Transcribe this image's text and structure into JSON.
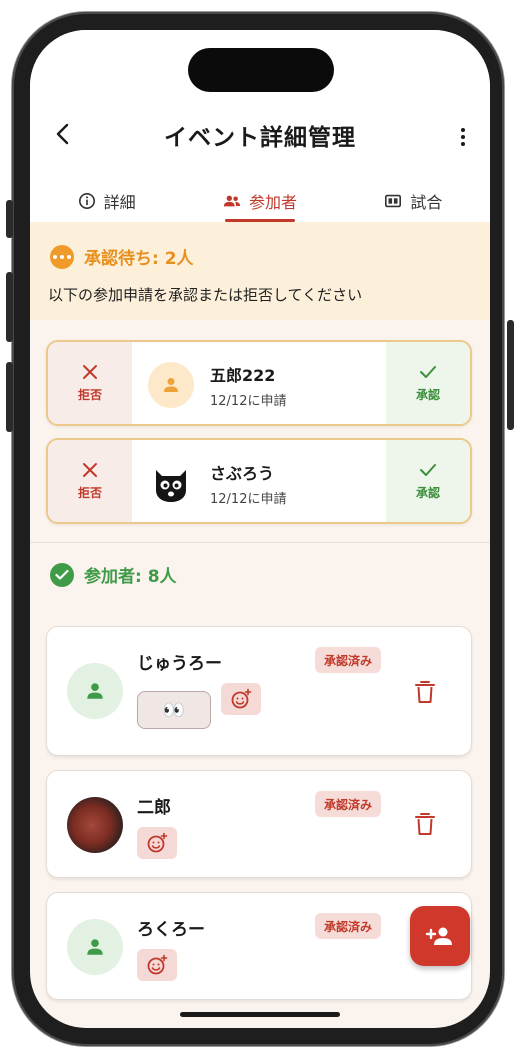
{
  "header": {
    "title": "イベント詳細管理"
  },
  "tabs": [
    {
      "label": "詳細",
      "icon": "info-icon"
    },
    {
      "label": "参加者",
      "icon": "people-icon",
      "active": true
    },
    {
      "label": "試合",
      "icon": "match-icon"
    }
  ],
  "pending": {
    "title": "承認待ち: 2人",
    "description": "以下の参加申請を承認または拒否してください",
    "reject_label": "拒否",
    "approve_label": "承認",
    "requests": [
      {
        "name": "五郎222",
        "date": "12/12に申請",
        "avatar": "person-icon"
      },
      {
        "name": "さぶろう",
        "date": "12/12に申請",
        "avatar": "cat-avatar"
      }
    ]
  },
  "participants": {
    "title": "参加者: 8人",
    "members": [
      {
        "name": "じゅうろー",
        "badge": "承認済み",
        "avatar": "person-icon",
        "reaction": "👀"
      },
      {
        "name": "二郎",
        "badge": "承認済み",
        "avatar": "photo"
      },
      {
        "name": "ろくろー",
        "badge": "承認済み",
        "avatar": "person-icon"
      }
    ]
  },
  "colors": {
    "accent": "#c0392b",
    "pending": "#e8901f",
    "success": "#3f9b47",
    "background": "#fbf4ee"
  }
}
